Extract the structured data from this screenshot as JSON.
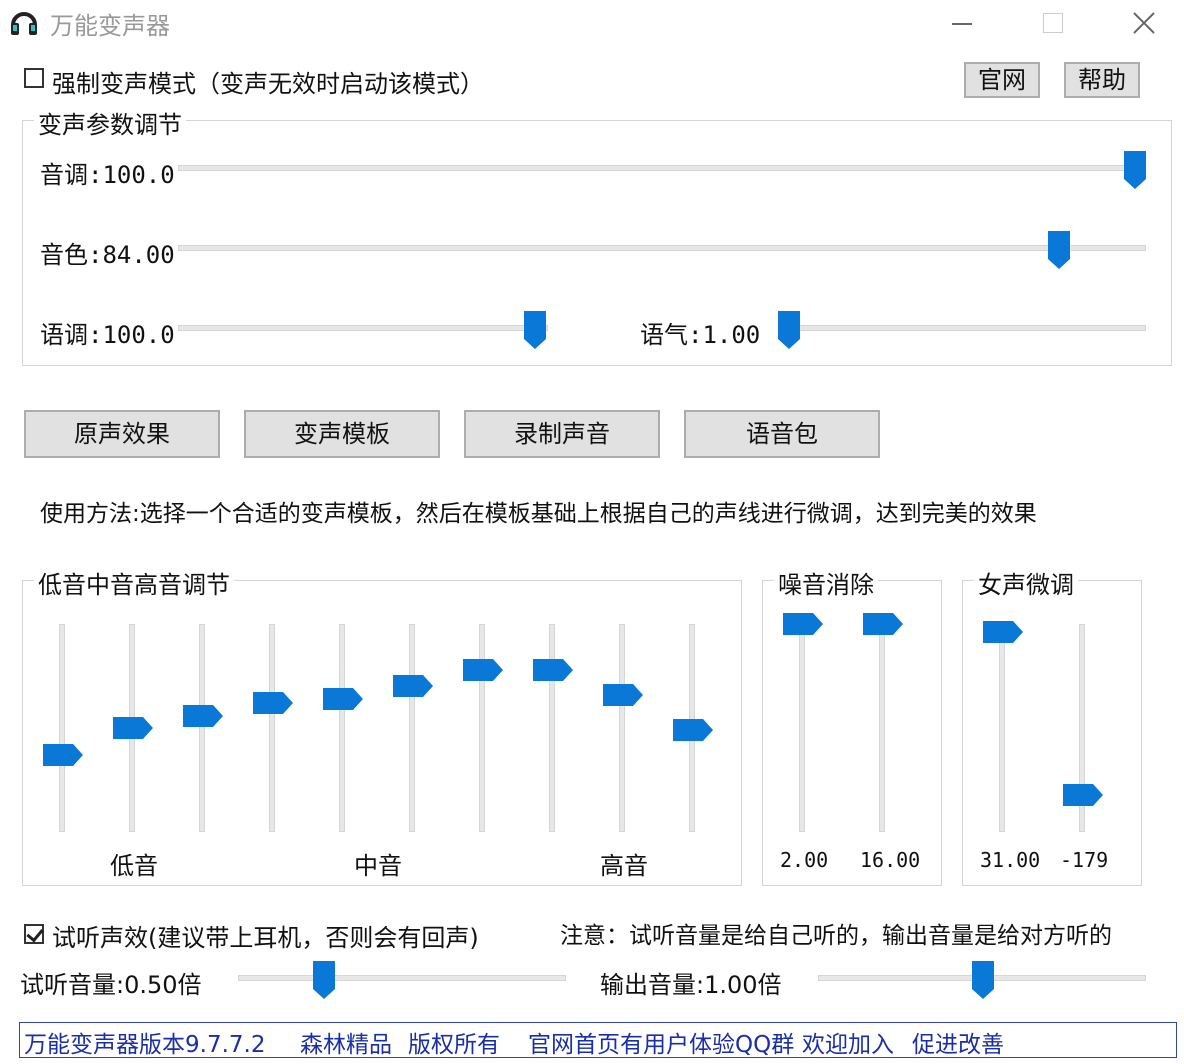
{
  "window": {
    "title": "万能变声器",
    "app_icon": "headphones-icon",
    "controls": [
      "minimize-icon",
      "maximize-icon",
      "close-icon"
    ]
  },
  "force_mode": {
    "label": "强制变声模式（变声无效时启动该模式）",
    "checked": false
  },
  "header_buttons": {
    "website": "官网",
    "help": "帮助"
  },
  "voice_params": {
    "title": "变声参数调节",
    "pitch": {
      "label": "音调:100.0",
      "level": 1.0
    },
    "timbre": {
      "label": "音色:84.00",
      "level": 0.92
    },
    "tone": {
      "label": "语调:100.0",
      "level": 0.5
    },
    "breath": {
      "label": "语气:1.00",
      "level": 0.0
    }
  },
  "actions": {
    "original": "原声效果",
    "templates": "变声模板",
    "record": "录制声音",
    "voice_pack": "语音包"
  },
  "usage_text": "使用方法:选择一个合适的变声模板，然后在模板基础上根据自己的声线进行微调，达到完美的效果",
  "eq": {
    "title": "低音中音高音调节",
    "bands": [
      0.37,
      0.5,
      0.56,
      0.62,
      0.64,
      0.7,
      0.78,
      0.78,
      0.66,
      0.49
    ],
    "labels": {
      "low": "低音",
      "mid": "中音",
      "high": "高音"
    }
  },
  "noise": {
    "title": "噪音消除",
    "sliders": [
      {
        "value": "2.00",
        "level": 1.0
      },
      {
        "value": "16.00",
        "level": 1.0
      }
    ]
  },
  "female": {
    "title": "女声微调",
    "sliders": [
      {
        "value": "31.00",
        "level": 0.96
      },
      {
        "value": "-179",
        "level": 0.18
      }
    ]
  },
  "monitor": {
    "label": "试听声效(建议带上耳机，否则会有回声)",
    "checked": true
  },
  "notice": "注意：试听音量是给自己听的，输出音量是给对方听的",
  "monitor_volume": {
    "label": "试听音量:0.50倍",
    "level": 0.26
  },
  "output_volume": {
    "label": "输出音量:1.00倍",
    "level": 0.5
  },
  "footer": {
    "version": "万能变声器版本9.7.7.2",
    "brand": "森林精品",
    "copyright": "版权所有",
    "group": "官网首页有用户体验QQ群",
    "welcome": "欢迎加入",
    "improve": "促进改善"
  },
  "colors": {
    "accent": "#0a78d7",
    "footer_text": "#1a2ea8"
  }
}
